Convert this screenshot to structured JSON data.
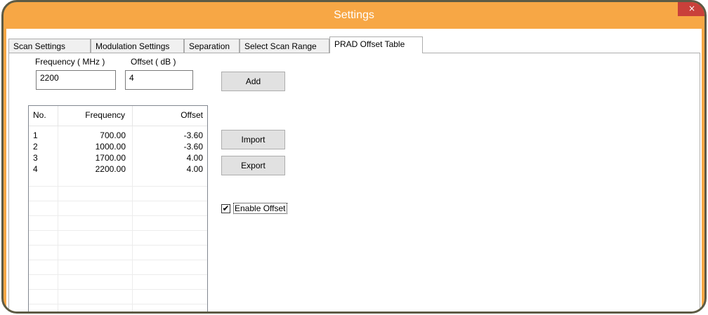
{
  "window": {
    "title": "Settings",
    "close_glyph": "×"
  },
  "tabs": [
    {
      "label": "Scan Settings"
    },
    {
      "label": "Modulation Settings"
    },
    {
      "label": "Separation"
    },
    {
      "label": "Select Scan Range"
    },
    {
      "label": "PRAD Offset Table",
      "active": true
    }
  ],
  "form": {
    "frequency_label": "Frequency ( MHz )",
    "offset_label": "Offset ( dB )",
    "frequency_value": "2200",
    "offset_value": "4",
    "add_label": "Add",
    "import_label": "Import",
    "export_label": "Export",
    "enable_offset_label": "Enable Offset",
    "enable_offset_checked": true,
    "check_glyph": "✔"
  },
  "table": {
    "columns": [
      "No.",
      "Frequency",
      "Offset"
    ],
    "rows": [
      [
        "1",
        "700.00",
        "-3.60"
      ],
      [
        "2",
        "1000.00",
        "-3.60"
      ],
      [
        "3",
        "1700.00",
        "4.00"
      ],
      [
        "4",
        "2200.00",
        "4.00"
      ]
    ]
  },
  "colors": {
    "titlebar": "#f7a745",
    "border": "#5d5b45",
    "close": "#c9403a"
  }
}
